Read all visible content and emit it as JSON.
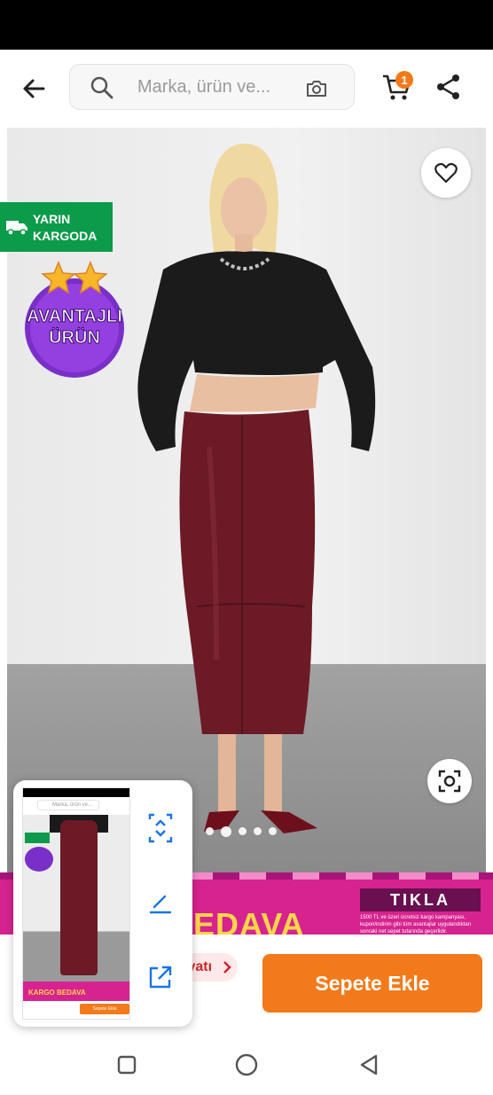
{
  "header": {
    "search_placeholder": "Marka, ürün ve...",
    "cart_count": "1"
  },
  "badges": {
    "cargo_line1": "YARIN",
    "cargo_line2": "KARGODA",
    "advantage_line1": "AVANTAJLI",
    "advantage_line2": "ÜRÜN"
  },
  "gallery": {
    "dot_count": 5,
    "active_index": 1
  },
  "promo": {
    "headline": "EDAVA",
    "cta": "TIKLA",
    "small_text": "1500 TL ve üzeri ücretsiz kargo kampanyası, kupon/indirim gibi tüm avantajlar uygulandıktan sonraki net sepet tutarında geçerlidir."
  },
  "bottom": {
    "price_chip": "iyatı",
    "add_to_cart": "Sepete Ekle"
  },
  "thumbnail": {
    "search_text": "Marka, ürün ve...",
    "promo_text": "KARGO BEDAVA",
    "button_text": "Sepete Ekle"
  },
  "colors": {
    "accent": "#f27a1a",
    "cargo_green": "#0c9b4a",
    "promo_pink": "#d6238f",
    "advantage_purple": "#7a2fc8",
    "skirt": "#6b1a26"
  }
}
